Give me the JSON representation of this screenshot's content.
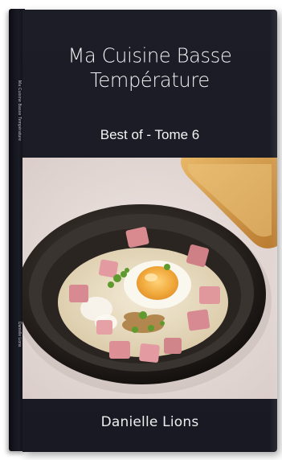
{
  "book": {
    "title_line_1": "Ma Cuisine Basse",
    "title_line_2": "Température",
    "subtitle": "Best of - Tome 6",
    "author": "Danielle Lions",
    "spine_title": "Ma Cuisine Basse Température",
    "spine_author": "Danielle Lions"
  },
  "colors": {
    "cover_background": "#1b1c26",
    "text": "#f2f2f2",
    "photo_background": "#e8dedc",
    "bowl": "#2a2522",
    "sauce": "#e6dcc3",
    "ham": "#d98a8f",
    "toast": "#d49b4a"
  },
  "photo": {
    "subject": "dish-photo"
  }
}
